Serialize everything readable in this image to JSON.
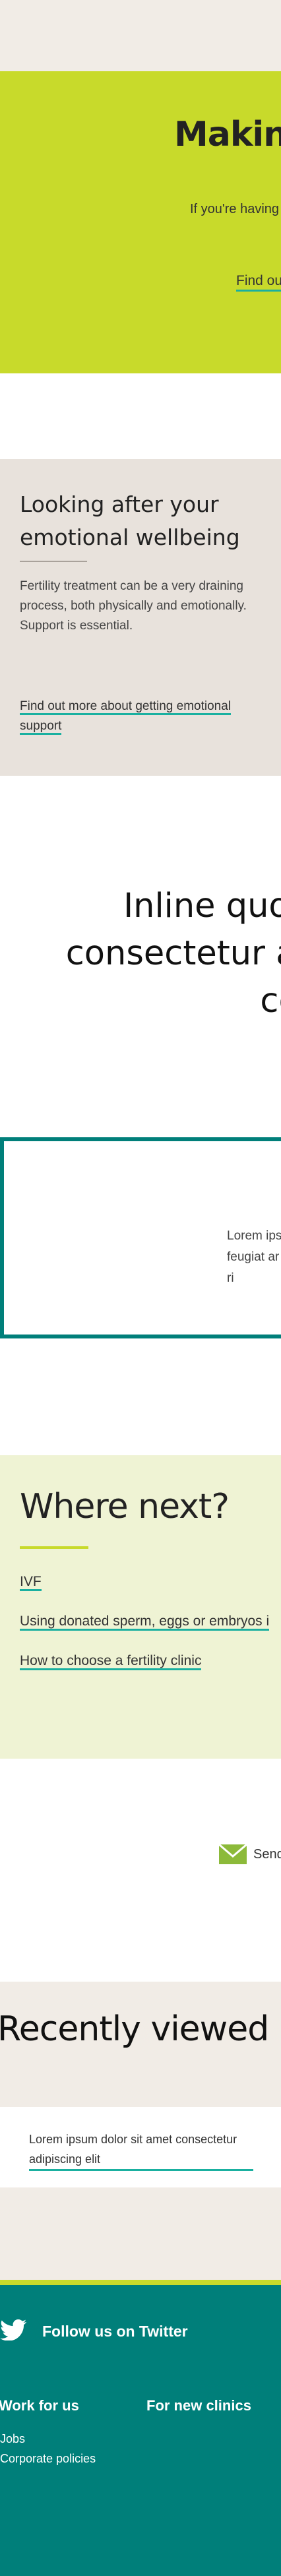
{
  "hero": {
    "title": "Making",
    "subtitle": "If you're having",
    "link": "Find out"
  },
  "wellbeing": {
    "title": "Looking after your emotional wellbeing",
    "body": "Fertility treatment can be a very draining process, both physically and emotionally. Support is essential.",
    "link": "Find out more about getting emotional support"
  },
  "quote": {
    "line1": "Inline quote",
    "line2": "consectetur adi",
    "line3": "con"
  },
  "boxed": {
    "text": "Lorem ipsum feugiat ar semper ri"
  },
  "where_next": {
    "title": "Where next?",
    "links": [
      "IVF",
      "Using donated sperm, eggs or embryos i",
      "How to choose a fertility clinic"
    ]
  },
  "send": {
    "label": "Send"
  },
  "recently_viewed": {
    "title": "Recently viewed",
    "item": "Lorem ipsum dolor sit amet consectetur adipiscing elit"
  },
  "footer": {
    "twitter_label": "Follow us on Twitter",
    "col1_title": "Work for us",
    "col2_title": "For new clinics",
    "links": [
      "Jobs",
      "Corporate policies"
    ]
  },
  "colors": {
    "hero_bg": "#c8da2b",
    "teal": "#007f7a",
    "link_underline": "#1ab0a0",
    "beige": "#e8e2dc",
    "pale_green": "#eff3d4"
  }
}
